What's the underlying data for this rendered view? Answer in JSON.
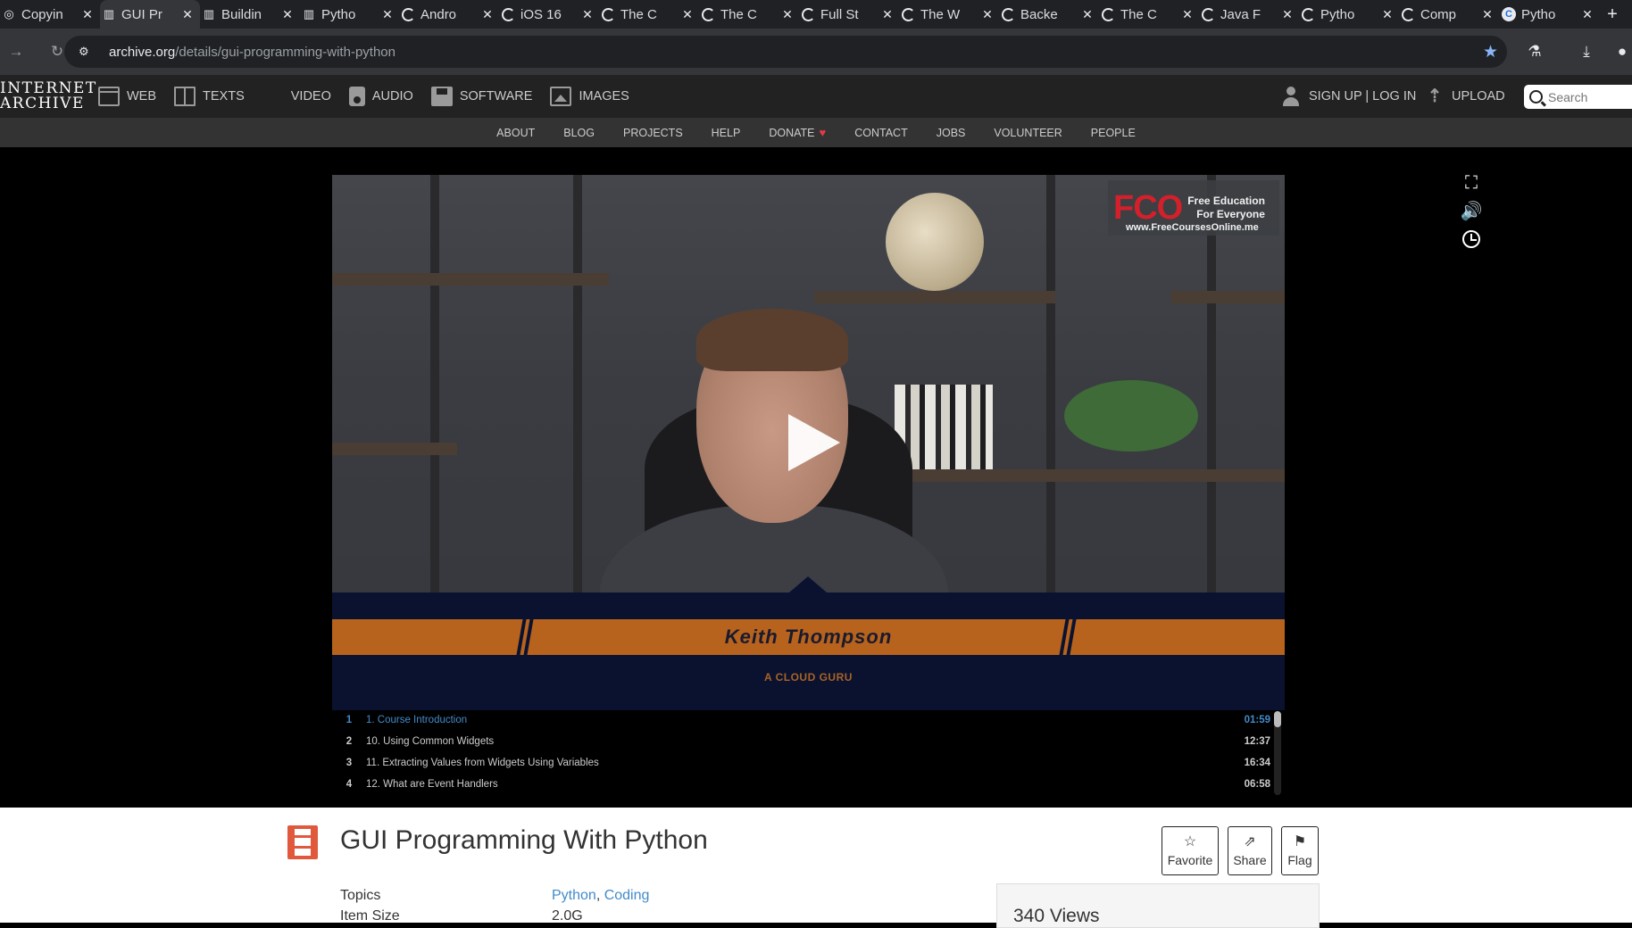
{
  "browser": {
    "tabs": [
      {
        "title": "Copyin",
        "icon": "copy-icon",
        "kind": "plain"
      },
      {
        "title": "GUI Pr",
        "icon": "archive-icon",
        "kind": "plain",
        "active": true
      },
      {
        "title": "Buildin",
        "icon": "archive-icon",
        "kind": "plain"
      },
      {
        "title": "Pytho",
        "icon": "archive-icon",
        "kind": "plain"
      },
      {
        "title": "Andro",
        "icon": "google-icon",
        "kind": "g"
      },
      {
        "title": "iOS 16",
        "icon": "google-icon",
        "kind": "g"
      },
      {
        "title": "The C",
        "icon": "google-icon",
        "kind": "g"
      },
      {
        "title": "The C",
        "icon": "google-icon",
        "kind": "g"
      },
      {
        "title": "Full St",
        "icon": "google-icon",
        "kind": "g"
      },
      {
        "title": "The W",
        "icon": "google-icon",
        "kind": "g"
      },
      {
        "title": "Backe",
        "icon": "google-icon",
        "kind": "g"
      },
      {
        "title": "The C",
        "icon": "google-icon",
        "kind": "g"
      },
      {
        "title": "Java F",
        "icon": "google-icon",
        "kind": "g"
      },
      {
        "title": "Pytho",
        "icon": "google-icon",
        "kind": "g"
      },
      {
        "title": "Comp",
        "icon": "google-icon",
        "kind": "g"
      },
      {
        "title": "Pytho",
        "icon": "c-icon",
        "kind": "c"
      }
    ],
    "url_host": "archive.org",
    "url_path": "/details/gui-programming-with-python"
  },
  "ia_header": {
    "logo_line1": "INTERNET",
    "logo_line2": "ARCHIVE",
    "media": [
      {
        "label": "WEB",
        "icon": "web"
      },
      {
        "label": "TEXTS",
        "icon": "texts"
      },
      {
        "label": "VIDEO",
        "icon": "video"
      },
      {
        "label": "AUDIO",
        "icon": "audio"
      },
      {
        "label": "SOFTWARE",
        "icon": "soft"
      },
      {
        "label": "IMAGES",
        "icon": "img"
      }
    ],
    "signup": "SIGN UP | LOG IN",
    "upload": "UPLOAD",
    "search_placeholder": "Search",
    "subnav": [
      "ABOUT",
      "BLOG",
      "PROJECTS",
      "HELP",
      "DONATE",
      "CONTACT",
      "JOBS",
      "VOLUNTEER",
      "PEOPLE"
    ]
  },
  "video": {
    "watermark_big": "FCO",
    "watermark_line1": "Free Education",
    "watermark_line2": "For Everyone",
    "watermark_url": "www.FreeCoursesOnline.me",
    "presenter_name": "Keith Thompson",
    "presenter_org": "A CLOUD GURU"
  },
  "playlist": [
    {
      "num": "1",
      "title": "1. Course Introduction",
      "duration": "01:59",
      "active": true
    },
    {
      "num": "2",
      "title": "10. Using Common Widgets",
      "duration": "12:37"
    },
    {
      "num": "3",
      "title": "11. Extracting Values from Widgets Using Variables",
      "duration": "16:34"
    },
    {
      "num": "4",
      "title": "12. What are Event Handlers",
      "duration": "06:58"
    }
  ],
  "item": {
    "title": "GUI Programming With Python",
    "actions": {
      "favorite": "Favorite",
      "share": "Share",
      "flag": "Flag"
    },
    "topics_label": "Topics",
    "topics": [
      "Python",
      "Coding"
    ],
    "size_label": "Item Size",
    "size_value": "2.0G",
    "views": "340 Views"
  },
  "colors": {
    "accent_link": "#428bca",
    "film_icon": "#e0593c",
    "donate_heart": "#e63946"
  }
}
